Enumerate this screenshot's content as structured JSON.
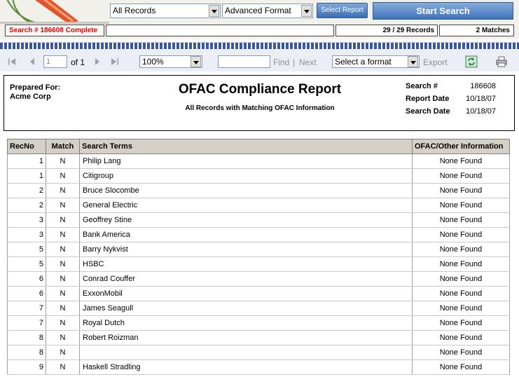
{
  "top": {
    "records_select": "All Records",
    "format_select": "Advanced Format",
    "select_report_label": "Select Report",
    "start_search_label": "Start Search"
  },
  "status": {
    "search_status": "Search # 186608 Complete",
    "records": "29 / 29 Records",
    "matches": "2 Matches"
  },
  "report_toolbar": {
    "page_value": "1",
    "of_pages": "of 1",
    "zoom": "100%",
    "find_label": "Find",
    "separator": "|",
    "next_label": "Next",
    "format_placeholder": "Select a format",
    "export_label": "Export"
  },
  "report": {
    "prepared_for_label": "Prepared For:",
    "prepared_for": "Acme Corp",
    "title": "OFAC Compliance Report",
    "subtitle": "All Records with Matching OFAC Information",
    "search_no_label": "Search #",
    "search_no": "186608",
    "report_date_label": "Report Date",
    "report_date": "10/18/07",
    "search_date_label": "Search Date",
    "search_date": "10/18/07"
  },
  "table": {
    "headers": [
      "RecNo",
      "Match",
      "Search Terms",
      "OFAC/Other Information"
    ],
    "rows": [
      {
        "rec": "1",
        "match": "N",
        "term": "Philip Lang",
        "info": "None Found"
      },
      {
        "rec": "1",
        "match": "N",
        "term": "Citigroup",
        "info": "None Found"
      },
      {
        "rec": "2",
        "match": "N",
        "term": "Bruce Slocombe",
        "info": "None Found"
      },
      {
        "rec": "2",
        "match": "N",
        "term": "General Electric",
        "info": "None Found"
      },
      {
        "rec": "3",
        "match": "N",
        "term": "Geoffrey Stine",
        "info": "None Found"
      },
      {
        "rec": "3",
        "match": "N",
        "term": "Bank America",
        "info": "None Found"
      },
      {
        "rec": "5",
        "match": "N",
        "term": "Barry Nykvist",
        "info": "None Found"
      },
      {
        "rec": "5",
        "match": "N",
        "term": "HSBC",
        "info": "None Found"
      },
      {
        "rec": "6",
        "match": "N",
        "term": "Conrad Couffer",
        "info": "None Found"
      },
      {
        "rec": "6",
        "match": "N",
        "term": "ExxonMobil",
        "info": "None Found"
      },
      {
        "rec": "7",
        "match": "N",
        "term": "James Seagull",
        "info": "None Found"
      },
      {
        "rec": "7",
        "match": "N",
        "term": "Royal Dutch",
        "info": "None Found"
      },
      {
        "rec": "8",
        "match": "N",
        "term": "Robert Roizman",
        "info": "None Found"
      },
      {
        "rec": "8",
        "match": "N",
        "term": "",
        "info": "None Found"
      },
      {
        "rec": "9",
        "match": "N",
        "term": "Haskell Stradling",
        "info": "None Found"
      }
    ]
  },
  "icons": [
    "logo-icon",
    "first-page-icon",
    "prev-page-icon",
    "next-page-icon",
    "last-page-icon",
    "refresh-icon",
    "print-icon",
    "chevron-down-icon"
  ],
  "colors": {
    "status_red": "#e00000",
    "button_blue": "#3f73b8",
    "toolbar_stripe": "#3a5797",
    "header_gray": "#d4d0c8"
  }
}
